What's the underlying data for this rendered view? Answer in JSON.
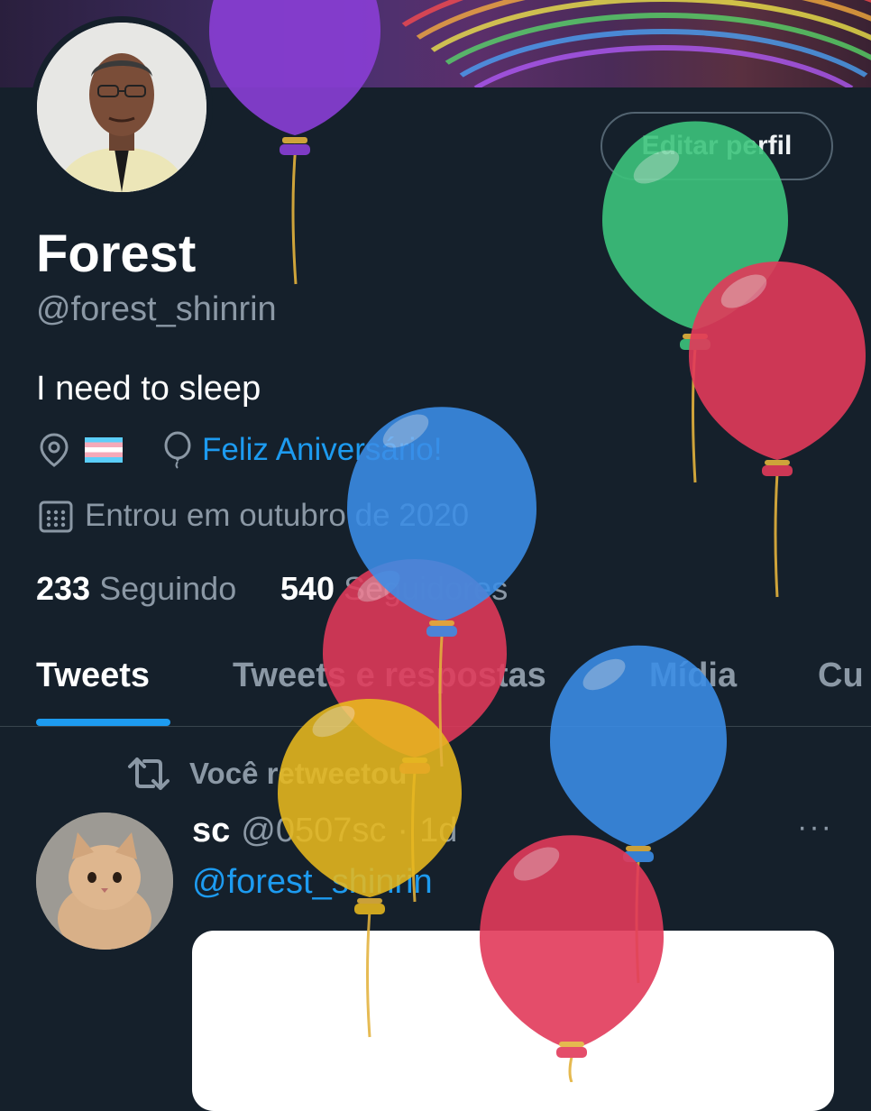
{
  "profile": {
    "name": "Forest",
    "handle": "@forest_shinrin",
    "bio": "I need to sleep",
    "location_flag": "🏳️‍⚧️",
    "birthday_link": "Feliz Aniversário!",
    "joined": "Entrou em outubro de 2020",
    "following_count": "233",
    "following_label": "Seguindo",
    "followers_count": "540",
    "followers_label": "Seguidores",
    "edit_button": "Editar perfil"
  },
  "tabs": [
    {
      "label": "Tweets",
      "active": true
    },
    {
      "label": "Tweets e respostas",
      "active": false
    },
    {
      "label": "Mídia",
      "active": false
    },
    {
      "label": "Cu",
      "active": false
    }
  ],
  "tweet": {
    "retweet_label": "Você retweetou",
    "author_name": "sc",
    "author_handle": "@0507sc",
    "separator": "·",
    "time": "1d",
    "mention": "@forest_shinrin",
    "more": "···"
  },
  "icons": {
    "location": "location-pin-icon",
    "birthday": "balloon-icon",
    "calendar": "calendar-icon",
    "retweet": "retweet-icon",
    "more": "more-icon"
  },
  "colors": {
    "background": "#15202b",
    "accent": "#1d9bf0",
    "secondary_text": "#8b98a5",
    "border": "#536471"
  },
  "balloons": [
    {
      "color": "#8a3ed6",
      "name": "purple"
    },
    {
      "color": "#3cc47c",
      "name": "green"
    },
    {
      "color": "#e23a5a",
      "name": "red"
    },
    {
      "color": "#3b8ee8",
      "name": "blue"
    },
    {
      "color": "#e23a5a",
      "name": "red"
    },
    {
      "color": "#e8b91e",
      "name": "yellow"
    },
    {
      "color": "#3b8ee8",
      "name": "blue"
    },
    {
      "color": "#e23a5a",
      "name": "red"
    }
  ]
}
